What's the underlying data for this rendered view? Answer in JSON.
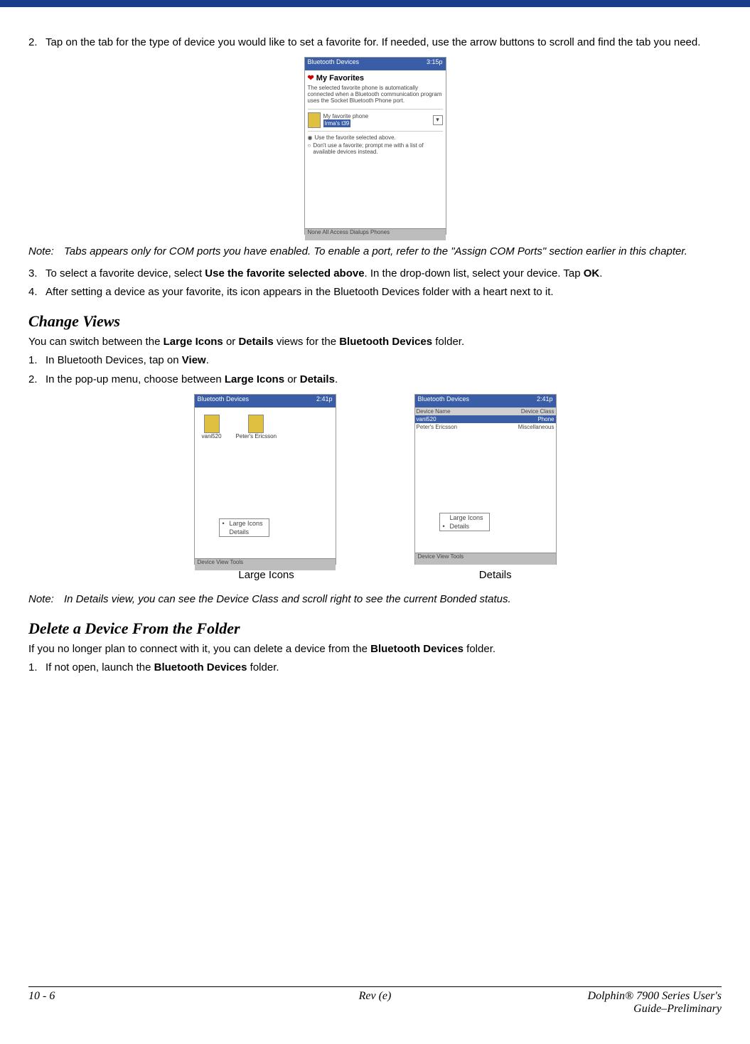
{
  "steps": {
    "s2_num": "2.",
    "s2_text_a": "Tap on the tab for the type of device you would like to set a favorite for. If needed, use the arrow buttons to scroll and find the tab you need.",
    "s3_num": "3.",
    "s3_text_a": "To select a favorite device, select ",
    "s3_bold": "Use the favorite selected above",
    "s3_text_b": ". In the drop-down list, select your device. Tap ",
    "s3_bold2": "OK",
    "s3_text_c": ".",
    "s4_num": "4.",
    "s4_text": "After setting a device as your favorite, its icon appears in the Bluetooth Devices folder with a heart next to it."
  },
  "note1": {
    "label": "Note:",
    "text": "Tabs appears only for COM ports you have enabled. To enable a port, refer to the \"Assign COM Ports\" section earlier in this chapter."
  },
  "change_views": {
    "heading": "Change Views",
    "intro_a": "You can switch between the ",
    "intro_b1": "Large Icons",
    "intro_c": " or ",
    "intro_b2": "Details",
    "intro_d": " views for the ",
    "intro_b3": "Bluetooth Devices",
    "intro_e": " folder.",
    "s1_num": "1.",
    "s1_a": "In Bluetooth Devices, tap on ",
    "s1_b": "View",
    "s1_c": ".",
    "s2_num": "2.",
    "s2_a": "In the pop-up menu, choose between ",
    "s2_b1": "Large Icons",
    "s2_c": " or ",
    "s2_b2": "Details",
    "s2_d": ".",
    "cap_left": "Large Icons",
    "cap_right": "Details"
  },
  "note2": {
    "label": "Note:",
    "text": "In Details view, you can see the Device Class and scroll right to see the current Bonded status."
  },
  "delete_section": {
    "heading": "Delete a Device From the Folder",
    "intro_a": "If you no longer plan to connect with it, you can delete a device from the ",
    "intro_b": "Bluetooth Devices",
    "intro_c": " folder.",
    "s1_num": "1.",
    "s1_a": "If not open, launch the ",
    "s1_b": "Bluetooth Devices",
    "s1_c": " folder."
  },
  "footer": {
    "left": "10 - 6",
    "center": "Rev (e)",
    "right1": "Dolphin® 7900 Series User's",
    "right2": "Guide–Preliminary"
  },
  "screenshots": {
    "fav_title": "Bluetooth Devices",
    "fav_time": "3:15p",
    "fav_heading": "My Favorites",
    "fav_desc": "The selected favorite phone is automatically connected when a Bluetooth communication program uses the Socket Bluetooth Phone port.",
    "fav_label": "My favorite phone",
    "fav_value": "Irma's t39",
    "fav_radio1": "Use the favorite selected above.",
    "fav_radio2": "Don't use a favorite; prompt me with a list of available devices instead.",
    "fav_bottom": "None  All Access  Dialups  Phones",
    "view_title": "Bluetooth Devices",
    "view_time": "2:41p",
    "view_icon1": "vani520",
    "view_icon2": "Peter's Ericsson",
    "view_menu1": "Large Icons",
    "view_menu2": "Details",
    "view_bottom": "Device  View  Tools",
    "det_col1": "Device Name",
    "det_col2": "Device Class",
    "det_r1c1": "vani520",
    "det_r1c2": "Phone",
    "det_r2c1": "Peter's Ericsson",
    "det_r2c2": "Miscellaneous"
  }
}
